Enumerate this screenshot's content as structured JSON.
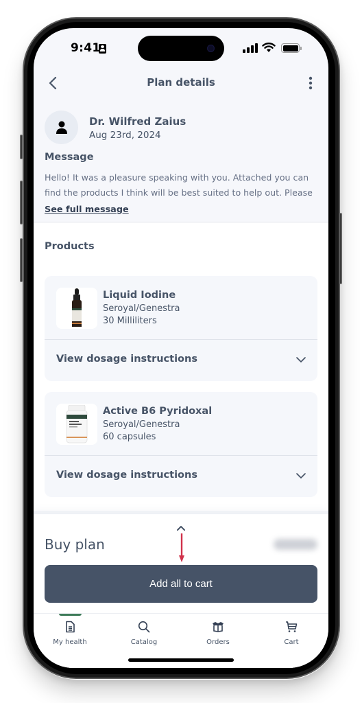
{
  "status_bar": {
    "time": "9:41",
    "icons": [
      "contact-card-icon",
      "cellular-signal-icon",
      "wifi-icon",
      "battery-icon"
    ]
  },
  "header": {
    "title": "Plan details",
    "back_icon": "chevron-left-icon",
    "more_icon": "more-vertical-icon"
  },
  "practitioner": {
    "name": "Dr. Wilfred Zaius",
    "date": "Aug 23rd, 2024",
    "avatar_icon": "person-icon"
  },
  "message": {
    "title": "Message",
    "body": "Hello! It was a pleasure speaking with you. Attached you can find the products I think will be best suited to help out. Please",
    "see_full_label": "See full message"
  },
  "products": {
    "title": "Products",
    "items": [
      {
        "name": "Liquid Iodine",
        "brand": "Seroyal/Genestra",
        "size": "30 Milliliters",
        "image_icon": "dropper-bottle-image",
        "dosage_label": "View dosage instructions"
      },
      {
        "name": "Active B6 Pyridoxal",
        "brand": "Seroyal/Genestra",
        "size": "60 capsules",
        "image_icon": "capsule-bottle-image",
        "dosage_label": "View dosage instructions"
      }
    ]
  },
  "buy_panel": {
    "title": "Buy plan",
    "price": "",
    "price_redacted": true,
    "add_all_label": "Add all to cart",
    "annotation": "red-down-arrow"
  },
  "tab_bar": {
    "active_index": 0,
    "active_color": "#3f7c5a",
    "items": [
      {
        "label": "My health",
        "icon": "document-icon"
      },
      {
        "label": "Catalog",
        "icon": "search-icon"
      },
      {
        "label": "Orders",
        "icon": "box-icon"
      },
      {
        "label": "Cart",
        "icon": "cart-icon"
      }
    ]
  },
  "colors": {
    "primary_button": "#465367",
    "text": "#475467",
    "annotation_arrow": "#d0314a"
  }
}
